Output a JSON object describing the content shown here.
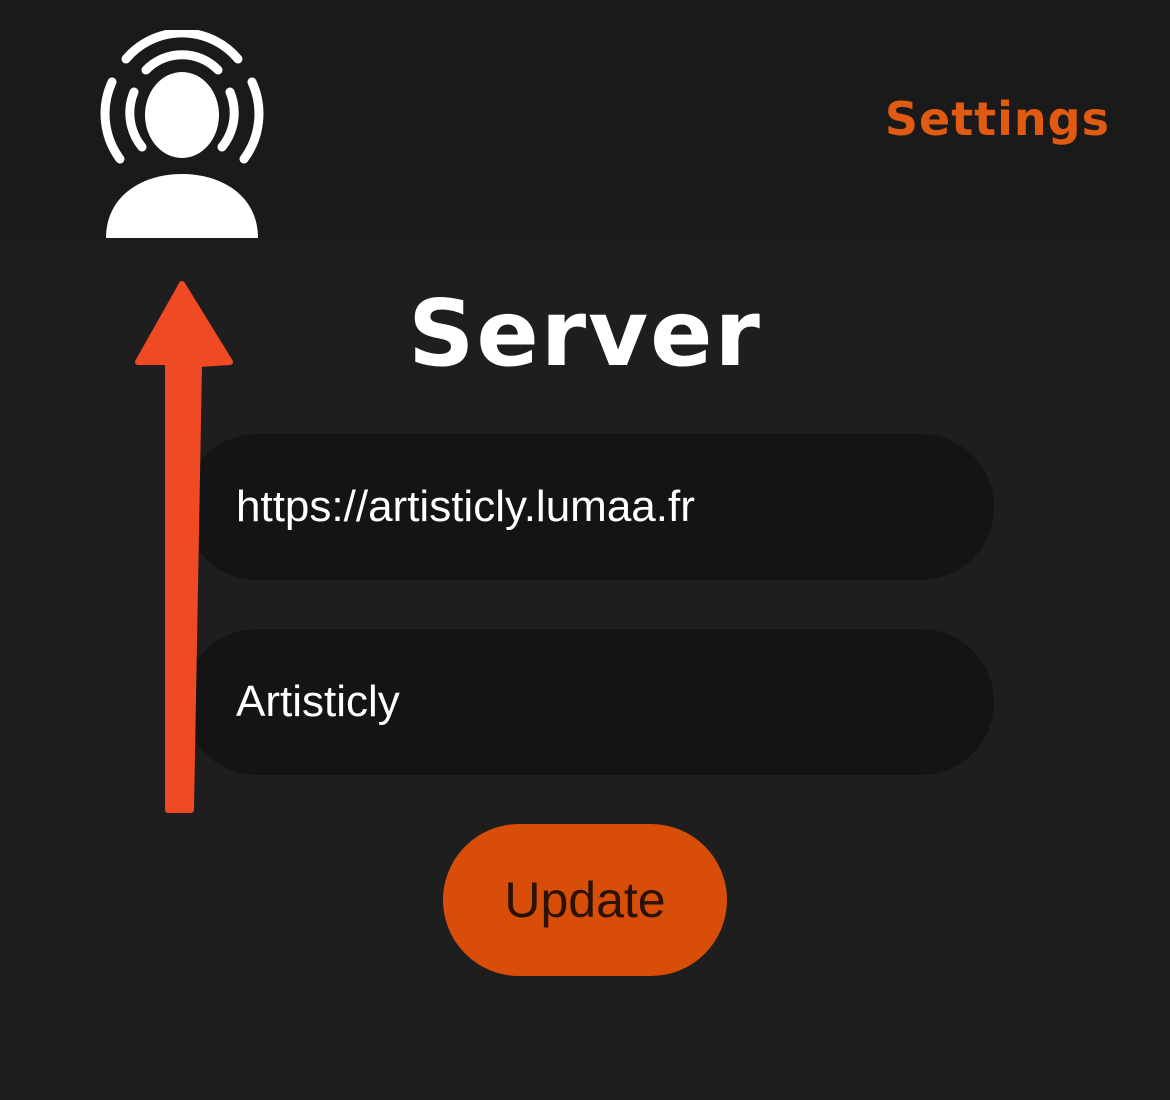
{
  "header": {
    "settings_label": "Settings",
    "profile_icon": "podcast-person-icon"
  },
  "main": {
    "title": "Server",
    "server_url_value": "https://artisticly.lumaa.fr",
    "server_name_value": "Artisticly",
    "update_label": "Update"
  },
  "annotation": {
    "arrow_icon": "arrow-up-icon"
  },
  "colors": {
    "accent": "#E05A12",
    "button_bg": "#D84E08",
    "background": "#1E1E1E",
    "topbar": "#1A1A1A",
    "field_bg": "#141414",
    "arrow": "#F04A24"
  }
}
